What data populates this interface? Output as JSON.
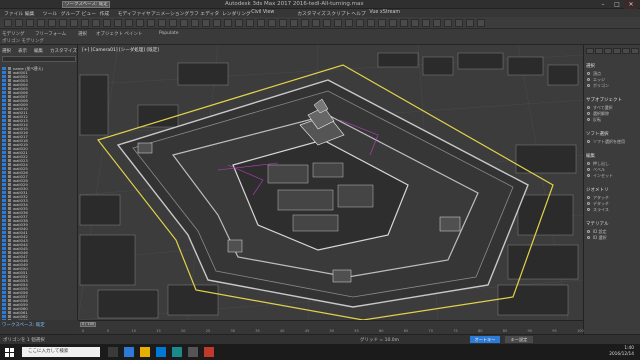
{
  "window": {
    "title": "Autodesk 3ds Max 2017 2016-tedl-All-turning.max",
    "workspace": "ワークスペース: 既定",
    "min": "–",
    "max": "□",
    "close": "✕"
  },
  "menu": [
    "ファイル",
    "編集",
    "ツール",
    "グループ",
    "ビュー",
    "作成",
    "モディファイヤ",
    "アニメーション",
    "グラフ エディタ",
    "レンダリング",
    "Civil View",
    "カスタマイズ",
    "スクリプト",
    "ヘルプ",
    "Vue xStream"
  ],
  "ribbon": {
    "tabs": [
      "モデリング",
      "フリーフォーム",
      "選択",
      "オブジェクト ペイント",
      "Populate"
    ],
    "sub": "ポリゴン モデリング"
  },
  "scene_explorer": {
    "tabs": [
      "選択",
      "表示",
      "編集",
      "カスタマイズ"
    ],
    "rows": [
      "name (並べ替え)",
      "wall001",
      "wall002",
      "wall003",
      "wall004",
      "wall005",
      "wall006",
      "wall007",
      "wall008",
      "wall009",
      "wall010",
      "wall011",
      "wall012",
      "wall013",
      "wall014",
      "wall015",
      "wall016",
      "wall017",
      "wall018",
      "wall019",
      "wall020",
      "wall021",
      "wall022",
      "wall023",
      "wall024",
      "wall025",
      "wall026",
      "wall027",
      "wall028",
      "wall029",
      "wall030",
      "wall031",
      "wall032",
      "wall033",
      "wall034",
      "wall035",
      "wall036",
      "wall037",
      "wall038",
      "wall039",
      "wall040",
      "wall041",
      "wall042",
      "wall043",
      "wall044",
      "wall045",
      "wall046",
      "wall047",
      "wall048",
      "wall049",
      "wall050",
      "wall051",
      "wall052",
      "wall053",
      "wall054",
      "wall055",
      "wall056",
      "wall057",
      "wall058",
      "wall059",
      "wall060",
      "wall061",
      "wall062",
      "wall063"
    ],
    "footer": "ワークスペース: 既定"
  },
  "viewport": {
    "label": "[+] [Camera01] [シーダ処理] [既定]"
  },
  "command_panel": {
    "sections": [
      {
        "title": "選択",
        "items": [
          "頂点",
          "エッジ",
          "ポリゴン"
        ]
      },
      {
        "title": "サブオブジェクト",
        "items": [
          "すべて選択",
          "選択解除",
          "反転"
        ]
      },
      {
        "title": "ソフト選択",
        "items": [
          "ソフト選択を使用"
        ]
      },
      {
        "title": "編集",
        "items": [
          "押し出し",
          "ベベル",
          "インセット"
        ]
      },
      {
        "title": "ジオメトリ",
        "items": [
          "アタッチ",
          "デタッチ",
          "スライス"
        ]
      },
      {
        "title": "マテリアル",
        "items": [
          "ID 設定",
          "ID 選択"
        ]
      }
    ]
  },
  "timeline": {
    "frame": "0 / 100",
    "ticks": [
      "0",
      "5",
      "10",
      "15",
      "20",
      "25",
      "30",
      "35",
      "40",
      "45",
      "50",
      "55",
      "60",
      "65",
      "70",
      "75",
      "80",
      "85",
      "90",
      "95",
      "100"
    ]
  },
  "status": {
    "message": "ポリゴンを 1 個選択",
    "grid": "グリッド = 10.0m",
    "autokey": "オートキー",
    "setkey": "キー設定"
  },
  "taskbar": {
    "search": "ここに入力して検索",
    "time": "1:40",
    "date": "2016/12/14"
  },
  "colors": {
    "accent_blue": "#2d7bd6",
    "boundary_yellow": "#e2d24a",
    "select_magenta": "#c040c0"
  }
}
